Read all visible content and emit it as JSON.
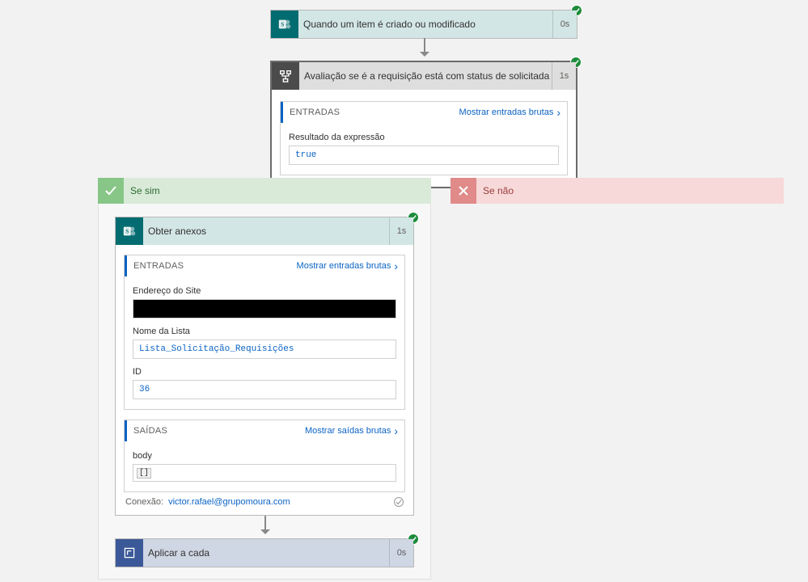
{
  "trigger": {
    "title": "Quando um item é criado ou modificado",
    "duration": "0s",
    "icon": "sharepoint-icon"
  },
  "condition": {
    "title": "Avaliação se é a requisição está com status de solicitada",
    "duration": "1s",
    "inputs": {
      "section_label": "ENTRADAS",
      "raw_link": "Mostrar entradas brutas",
      "result_label": "Resultado da expressão",
      "result_value": "true"
    },
    "branches": {
      "yes_label": "Se sim",
      "no_label": "Se não"
    }
  },
  "get_attachments": {
    "title": "Obter anexos",
    "duration": "1s",
    "inputs": {
      "section_label": "ENTRADAS",
      "raw_link": "Mostrar entradas brutas",
      "site_label": "Endereço do Site",
      "site_value": "",
      "list_label": "Nome da Lista",
      "list_value": "Lista_Solicitação_Requisições",
      "id_label": "ID",
      "id_value": "36"
    },
    "outputs": {
      "section_label": "SAÍDAS",
      "raw_link": "Mostrar saídas brutas",
      "body_label": "body",
      "body_value": "[]"
    },
    "connection": {
      "label": "Conexão:",
      "account": "victor.rafael@grupomoura.com"
    }
  },
  "apply_each": {
    "title": "Aplicar a cada",
    "duration": "0s"
  }
}
